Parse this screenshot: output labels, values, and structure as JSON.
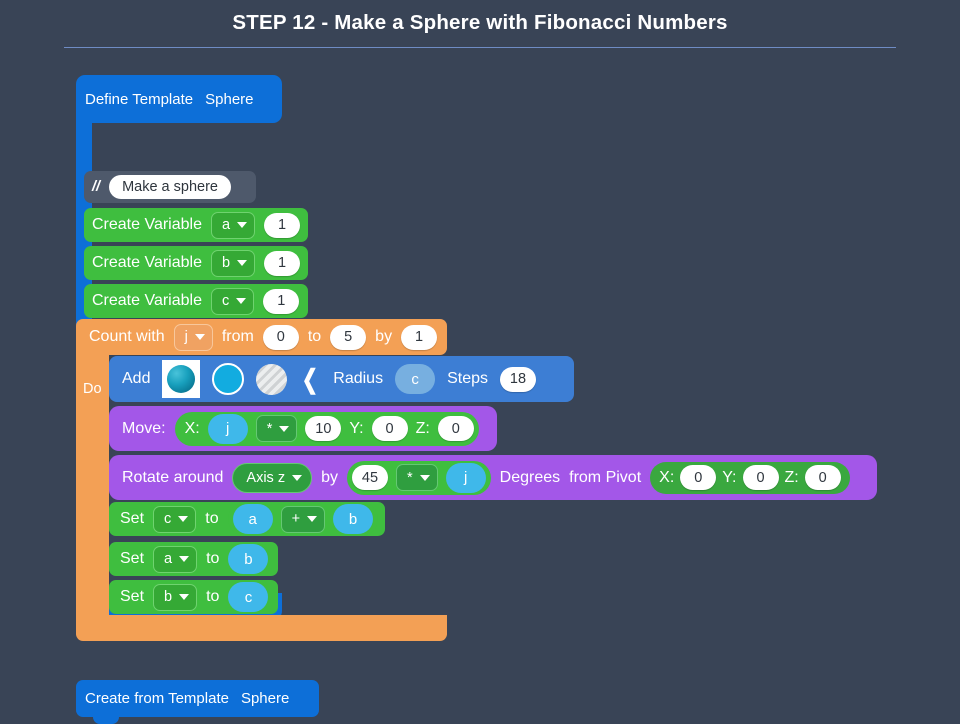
{
  "header": {
    "title": "STEP 12 - Make a Sphere with Fibonacci Numbers"
  },
  "colors": {
    "background": "#394456",
    "define_blue": "#0d6fd8",
    "add_blue": "#3d7ed4",
    "variable_green": "#3fbe3f",
    "loop_orange": "#f3a055",
    "transform_purple": "#a357e8",
    "comment_gray": "#4e596b",
    "value_oval": "#3fb8ea",
    "title_rule": "#6f8cc4"
  },
  "program": {
    "define": {
      "keyword": "Define Template",
      "template_name": "Sphere"
    },
    "comment": {
      "marker": "//",
      "text": "Make a sphere"
    },
    "create_variables": [
      {
        "keyword": "Create Variable",
        "variable": "a",
        "value": "1"
      },
      {
        "keyword": "Create Variable",
        "variable": "b",
        "value": "1"
      },
      {
        "keyword": "Create Variable",
        "variable": "c",
        "value": "1"
      }
    ],
    "count_loop": {
      "keyword": "Count with",
      "variable": "j",
      "from_label": "from",
      "from_value": "0",
      "to_label": "to",
      "to_value": "5",
      "by_label": "by",
      "by_value": "1",
      "do_label": "Do"
    },
    "add_shape": {
      "keyword": "Add",
      "shape_options": [
        "solid-sphere-icon",
        "outline-sphere-icon",
        "hatched-sphere-icon"
      ],
      "selected_shape": "solid-sphere-icon",
      "collapse_icon": "chevron-left-icon",
      "radius_label": "Radius",
      "radius_value": "c",
      "steps_label": "Steps",
      "steps_value": "18"
    },
    "move": {
      "keyword": "Move:",
      "x_label": "X:",
      "x_operand_a": "j",
      "x_operator": "*",
      "x_operand_b": "10",
      "y_label": "Y:",
      "y_value": "0",
      "z_label": "Z:",
      "z_value": "0"
    },
    "rotate": {
      "keyword": "Rotate around",
      "axis": "Axis z",
      "by_label": "by",
      "angle_operand_a": "45",
      "angle_operator": "*",
      "angle_operand_b": "j",
      "units_label": "Degrees",
      "pivot_label": "from Pivot",
      "pivot_x_label": "X:",
      "pivot_x": "0",
      "pivot_y_label": "Y:",
      "pivot_y": "0",
      "pivot_z_label": "Z:",
      "pivot_z": "0"
    },
    "set_statements": [
      {
        "keyword": "Set",
        "variable": "c",
        "to_label": "to",
        "operand_a": "a",
        "operator": "+",
        "operand_b": "b"
      },
      {
        "keyword": "Set",
        "variable": "a",
        "to_label": "to",
        "operand_a": "b",
        "operator": null,
        "operand_b": null
      },
      {
        "keyword": "Set",
        "variable": "b",
        "to_label": "to",
        "operand_a": "c",
        "operator": null,
        "operand_b": null
      }
    ],
    "create_from_template": {
      "keyword": "Create from Template",
      "template_name": "Sphere"
    }
  }
}
